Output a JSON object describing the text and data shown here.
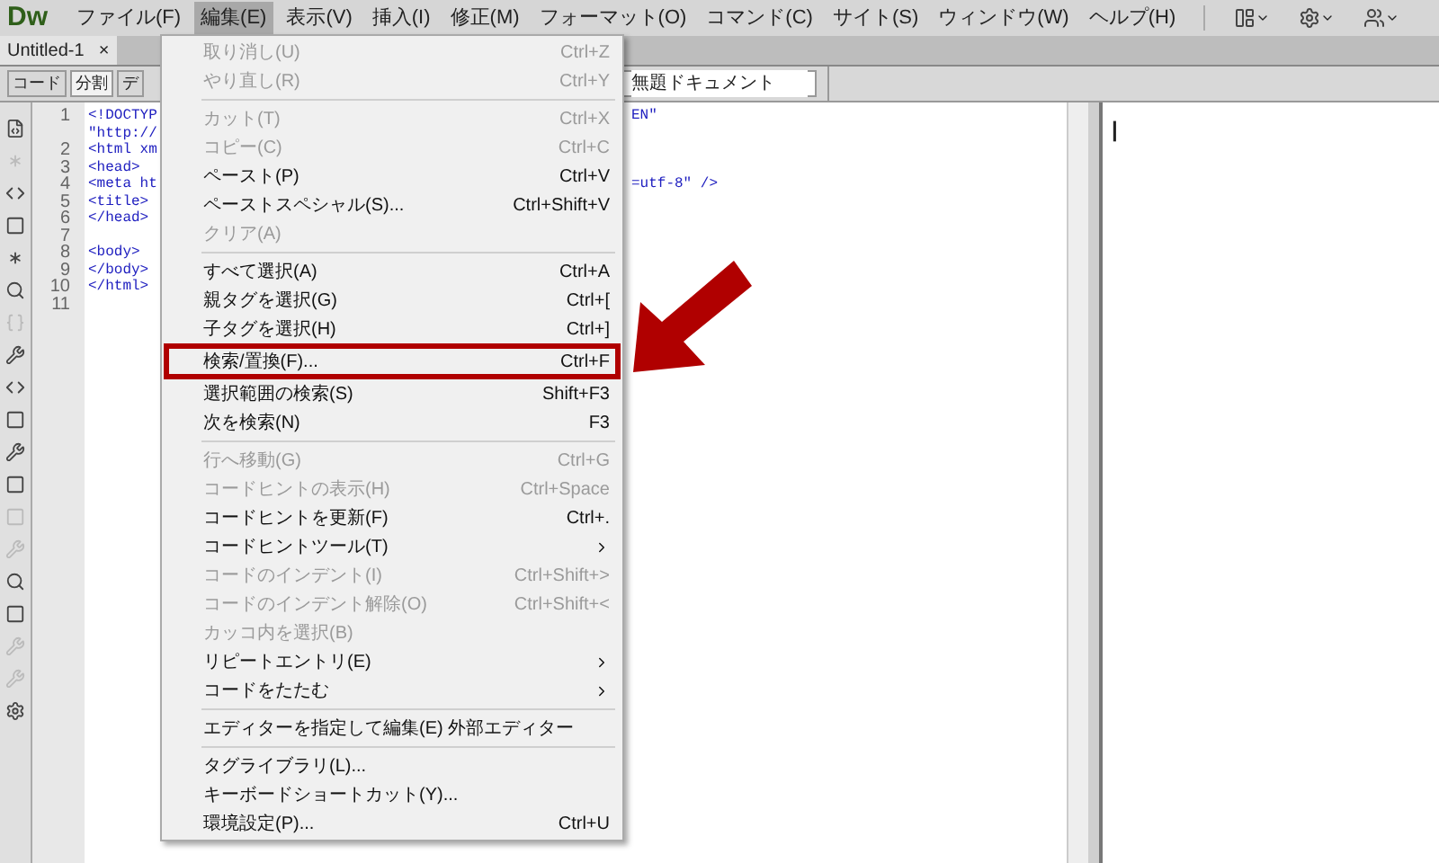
{
  "app": {
    "logo": "Dw"
  },
  "menubar": [
    {
      "label": "ファイル(F)",
      "selected": false
    },
    {
      "label": "編集(E)",
      "selected": true
    },
    {
      "label": "表示(V)",
      "selected": false
    },
    {
      "label": "挿入(I)",
      "selected": false
    },
    {
      "label": "修正(M)",
      "selected": false
    },
    {
      "label": "フォーマット(O)",
      "selected": false
    },
    {
      "label": "コマンド(C)",
      "selected": false
    },
    {
      "label": "サイト(S)",
      "selected": false
    },
    {
      "label": "ウィンドウ(W)",
      "selected": false
    },
    {
      "label": "ヘルプ(H)",
      "selected": false
    }
  ],
  "document_tab": {
    "label": "Untitled-1",
    "close": "×"
  },
  "view_buttons": [
    {
      "label": "コード",
      "selected": false
    },
    {
      "label": "分割",
      "selected": true
    },
    {
      "label": "デ",
      "selected": false
    }
  ],
  "title_field": {
    "value": "無題ドキュメント"
  },
  "tool_strip": [
    {
      "disabled": false
    },
    {
      "disabled": true
    },
    {
      "disabled": false
    },
    {
      "disabled": false
    },
    {
      "disabled": false
    },
    {
      "disabled": false
    },
    {
      "disabled": true
    },
    {
      "disabled": false
    },
    {
      "disabled": false
    },
    {
      "disabled": false
    },
    {
      "disabled": false
    },
    {
      "disabled": false
    },
    {
      "disabled": true
    },
    {
      "disabled": true
    },
    {
      "disabled": false
    },
    {
      "disabled": false
    },
    {
      "disabled": true
    },
    {
      "disabled": true
    },
    {
      "disabled": false
    }
  ],
  "code_lines": [
    {
      "number": "1",
      "text": "<!DOCTYP",
      "tail": "EN\""
    },
    {
      "text": "\"http://"
    },
    {
      "number": "2",
      "text": "<html xm"
    },
    {
      "number": "3",
      "text": "<head>"
    },
    {
      "number": "4",
      "text": "<meta ht",
      "tail": "=utf-8\" />"
    },
    {
      "number": "5",
      "text": "<title>"
    },
    {
      "number": "6",
      "text": "</head>"
    },
    {
      "number": "7"
    },
    {
      "number": "8",
      "text": "<body>"
    },
    {
      "number": "9",
      "text": "</body>"
    },
    {
      "number": "10",
      "text": "</html>"
    },
    {
      "number": "11"
    }
  ],
  "design_view": {
    "caret": "|"
  },
  "edit_menu": [
    {
      "kind": "item",
      "label": "取り消し(U)",
      "shortcut": "Ctrl+Z",
      "disabled": true,
      "highlighted": false
    },
    {
      "kind": "item",
      "label": "やり直し(R)",
      "shortcut": "Ctrl+Y",
      "disabled": true,
      "highlighted": false
    },
    {
      "kind": "separator"
    },
    {
      "kind": "item",
      "label": "カット(T)",
      "shortcut": "Ctrl+X",
      "disabled": true,
      "highlighted": false
    },
    {
      "kind": "item",
      "label": "コピー(C)",
      "shortcut": "Ctrl+C",
      "disabled": true,
      "highlighted": false
    },
    {
      "kind": "item",
      "label": "ペースト(P)",
      "shortcut": "Ctrl+V",
      "disabled": false,
      "highlighted": false
    },
    {
      "kind": "item",
      "label": "ペーストスペシャル(S)...",
      "shortcut": "Ctrl+Shift+V",
      "disabled": false,
      "highlighted": false
    },
    {
      "kind": "item",
      "label": "クリア(A)",
      "disabled": true,
      "highlighted": false
    },
    {
      "kind": "separator"
    },
    {
      "kind": "item",
      "label": "すべて選択(A)",
      "shortcut": "Ctrl+A",
      "disabled": false,
      "highlighted": false
    },
    {
      "kind": "item",
      "label": "親タグを選択(G)",
      "shortcut": "Ctrl+[",
      "disabled": false,
      "highlighted": false
    },
    {
      "kind": "item",
      "label": "子タグを選択(H)",
      "shortcut": "Ctrl+]",
      "disabled": false,
      "highlighted": false
    },
    {
      "kind": "item",
      "label": "検索/置換(F)...",
      "shortcut": "Ctrl+F",
      "disabled": false,
      "highlighted": true
    },
    {
      "kind": "item",
      "label": "選択範囲の検索(S)",
      "shortcut": "Shift+F3",
      "disabled": false,
      "highlighted": false
    },
    {
      "kind": "item",
      "label": "次を検索(N)",
      "shortcut": "F3",
      "disabled": false,
      "highlighted": false
    },
    {
      "kind": "separator"
    },
    {
      "kind": "item",
      "label": "行へ移動(G)",
      "shortcut": "Ctrl+G",
      "disabled": true,
      "highlighted": false
    },
    {
      "kind": "item",
      "label": "コードヒントの表示(H)",
      "shortcut": "Ctrl+Space",
      "disabled": true,
      "highlighted": false
    },
    {
      "kind": "item",
      "label": "コードヒントを更新(F)",
      "shortcut": "Ctrl+.",
      "disabled": false,
      "highlighted": false
    },
    {
      "kind": "item",
      "label": "コードヒントツール(T)",
      "submenu": true,
      "disabled": false,
      "highlighted": false
    },
    {
      "kind": "item",
      "label": "コードのインデント(I)",
      "shortcut": "Ctrl+Shift+>",
      "disabled": true,
      "highlighted": false
    },
    {
      "kind": "item",
      "label": "コードのインデント解除(O)",
      "shortcut": "Ctrl+Shift+<",
      "disabled": true,
      "highlighted": false
    },
    {
      "kind": "item",
      "label": "カッコ内を選択(B)",
      "disabled": true,
      "highlighted": false
    },
    {
      "kind": "item",
      "label": "リピートエントリ(E)",
      "submenu": true,
      "disabled": false,
      "highlighted": false
    },
    {
      "kind": "item",
      "label": "コードをたたむ",
      "submenu": true,
      "disabled": false,
      "highlighted": false
    },
    {
      "kind": "separator"
    },
    {
      "kind": "item",
      "label": "エディターを指定して編集(E) 外部エディター",
      "disabled": false,
      "highlighted": false
    },
    {
      "kind": "separator"
    },
    {
      "kind": "item",
      "label": "タグライブラリ(L)...",
      "disabled": false,
      "highlighted": false
    },
    {
      "kind": "item",
      "label": "キーボードショートカット(Y)...",
      "disabled": false,
      "highlighted": false
    },
    {
      "kind": "item",
      "label": "環境設定(P)...",
      "shortcut": "Ctrl+U",
      "disabled": false,
      "highlighted": false
    }
  ]
}
